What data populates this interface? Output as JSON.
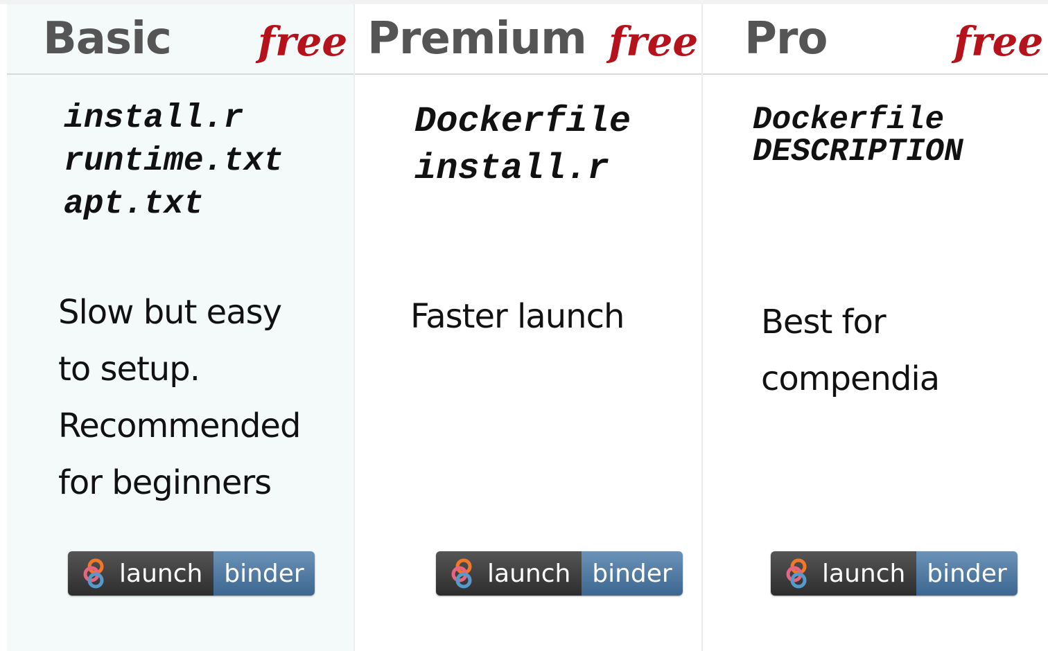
{
  "tiers": [
    {
      "name": "Basic",
      "price": "free",
      "files": [
        "install.r",
        "runtime.txt",
        "apt.txt"
      ],
      "description": [
        "Slow but easy",
        "to setup.",
        "Recommended",
        "for beginners"
      ],
      "badge": {
        "left": "launch",
        "right": "binder"
      }
    },
    {
      "name": "Premium",
      "price": "free",
      "files": [
        "Dockerfile",
        "install.r"
      ],
      "description": [
        "Faster launch"
      ],
      "badge": {
        "left": "launch",
        "right": "binder"
      }
    },
    {
      "name": "Pro",
      "price": "free",
      "files": [
        "Dockerfile",
        "DESCRIPTION"
      ],
      "description": [
        "Best for",
        "compendia"
      ],
      "badge": {
        "left": "launch",
        "right": "binder"
      }
    }
  ],
  "colors": {
    "price": "#b5121b",
    "tier_name": "#555555",
    "badge_left": "#3a3a3a",
    "badge_right": "#4f7aa3",
    "basic_background": "#f4f9fa"
  },
  "icons": {
    "badge_logo": "binder-logo-icon"
  }
}
